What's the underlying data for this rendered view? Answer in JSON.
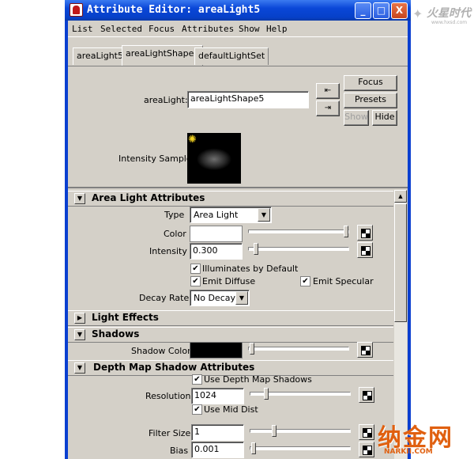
{
  "window": {
    "title": "Attribute Editor: areaLight5",
    "min": "_",
    "max": "□",
    "close": "X"
  },
  "menu": [
    "List",
    "Selected",
    "Focus",
    "Attributes",
    "Show",
    "Help"
  ],
  "tabs": [
    {
      "label": "areaLight5",
      "active": false
    },
    {
      "label": "areaLightShape5",
      "active": true
    },
    {
      "label": "defaultLightSet",
      "active": false
    }
  ],
  "header": {
    "node_label": "areaLight:",
    "node_value": "areaLightShape5",
    "focus": "Focus",
    "presets": "Presets",
    "show": "Show",
    "hide": "Hide",
    "intensity_sample": "Intensity Sample"
  },
  "area_light": {
    "title": "Area Light Attributes",
    "type_label": "Type",
    "type_value": "Area Light",
    "color_label": "Color",
    "intensity_label": "Intensity",
    "intensity_value": "0.300",
    "illuminates_label": "Illuminates by Default",
    "emit_diffuse_label": "Emit Diffuse",
    "emit_specular_label": "Emit Specular",
    "decay_label": "Decay Rate",
    "decay_value": "No Decay"
  },
  "light_effects": {
    "title": "Light Effects"
  },
  "shadows": {
    "title": "Shadows",
    "shadow_color_label": "Shadow Color"
  },
  "depth_map": {
    "title": "Depth Map Shadow Attributes",
    "use_depth_label": "Use Depth Map Shadows",
    "resolution_label": "Resolution",
    "resolution_value": "1024",
    "use_mid_label": "Use Mid Dist",
    "filter_label": "Filter Size",
    "filter_value": "1",
    "bias_label": "Bias",
    "bias_value": "0.001"
  },
  "checkmark": "✔",
  "arrows": {
    "down": "▼",
    "right": "▶",
    "up": "▲"
  },
  "watermark_top": {
    "brand": "火星时代",
    "url": "www.hxsd.com"
  },
  "watermark_bottom": {
    "brand": "纳金网",
    "url": "NARKII.COM"
  },
  "colors": {
    "title_bar": "#0a47d8",
    "panel": "#d4d0c8",
    "shadow_color": "#000000",
    "light_color": "#ffffff"
  }
}
